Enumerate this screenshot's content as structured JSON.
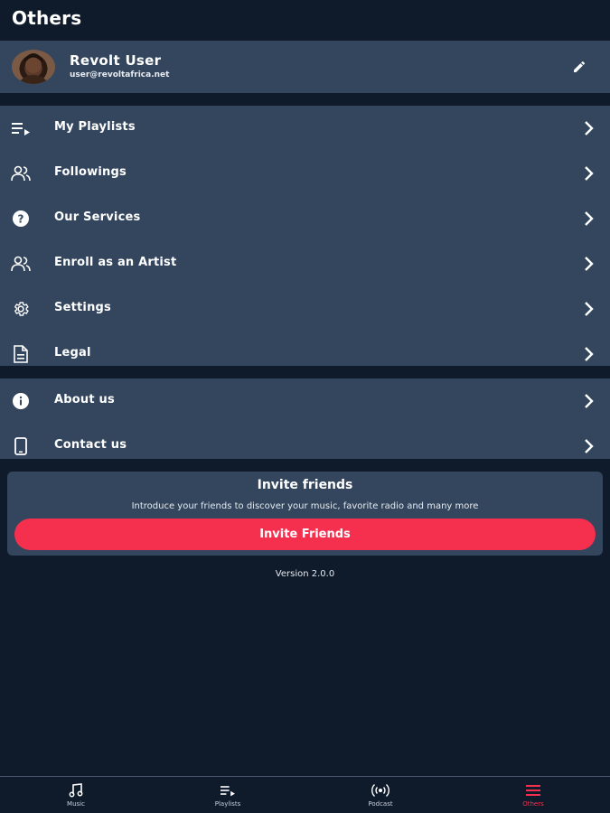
{
  "header": {
    "title": "Others"
  },
  "profile": {
    "name": "Revolt  User",
    "email": "user@revoltafrica.net",
    "avatar_icon": "user-avatar",
    "edit_icon": "pencil-icon"
  },
  "menu_primary": [
    {
      "label": "My Playlists",
      "icon": "playlist-icon"
    },
    {
      "label": "Followings",
      "icon": "people-icon"
    },
    {
      "label": "Our Services",
      "icon": "help-circle-icon"
    },
    {
      "label": "Enroll as an Artist",
      "icon": "people-icon"
    },
    {
      "label": "Settings",
      "icon": "gear-icon"
    },
    {
      "label": "Legal",
      "icon": "document-icon"
    }
  ],
  "menu_secondary": [
    {
      "label": "About us",
      "icon": "info-icon"
    },
    {
      "label": "Contact us",
      "icon": "phone-icon"
    }
  ],
  "invite": {
    "title": "Invite friends",
    "description": "Introduce your friends to discover your music, favorite radio and many more",
    "button_label": "Invite Friends"
  },
  "version": "Version 2.0.0",
  "bottom_nav": [
    {
      "label": "Music",
      "icon": "music-note-icon",
      "active": false
    },
    {
      "label": "Playlists",
      "icon": "playlist-icon",
      "active": false
    },
    {
      "label": "Podcast",
      "icon": "broadcast-icon",
      "active": false
    },
    {
      "label": "Others",
      "icon": "menu-icon",
      "active": true
    }
  ],
  "colors": {
    "background": "#0f1a2a",
    "card": "#33465d",
    "accent": "#f5304f"
  }
}
